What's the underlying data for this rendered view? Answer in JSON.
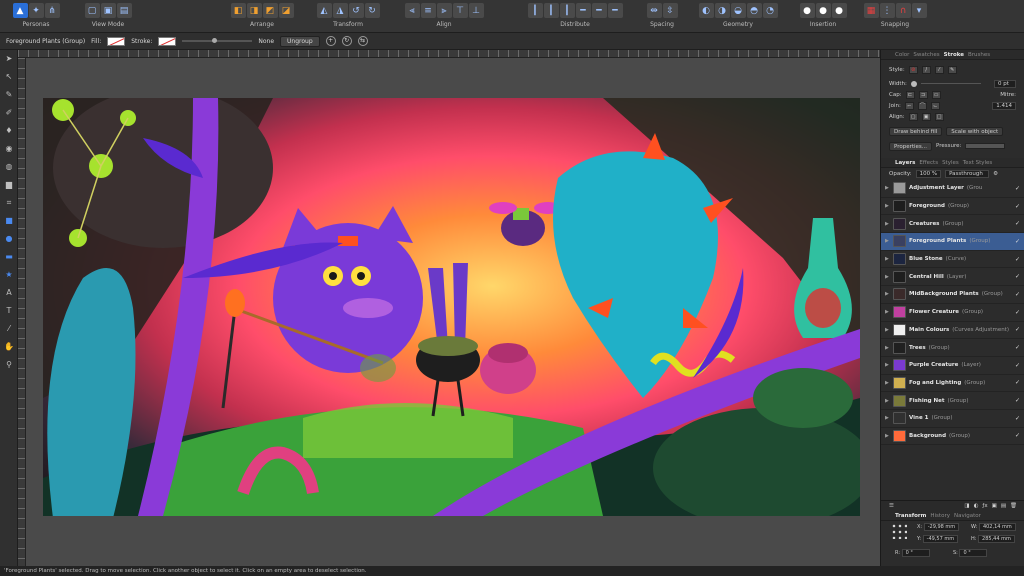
{
  "toolbar": {
    "groups": [
      {
        "label": "Personas",
        "icons": [
          "designer-persona-icon",
          "pixel-persona-icon",
          "export-persona-icon"
        ]
      },
      {
        "label": "View Mode",
        "icons": [
          "view-mode-1-icon",
          "view-mode-2-icon",
          "view-mode-3-icon"
        ]
      },
      {
        "label": "Arrange",
        "icons": [
          "arrange-back-icon",
          "arrange-backward-icon",
          "arrange-forward-icon",
          "arrange-front-icon"
        ]
      },
      {
        "label": "Transform",
        "icons": [
          "flip-horizontal-icon",
          "flip-vertical-icon",
          "rotate-left-icon",
          "rotate-right-icon"
        ]
      },
      {
        "label": "Align",
        "icons": [
          "align-left-icon",
          "align-center-icon",
          "align-right-icon",
          "align-top-icon",
          "align-middle-icon"
        ]
      },
      {
        "label": "Distribute",
        "icons": [
          "distribute-1-icon",
          "distribute-2-icon",
          "distribute-3-icon",
          "distribute-4-icon",
          "distribute-5-icon",
          "distribute-6-icon"
        ]
      },
      {
        "label": "Spacing",
        "icons": [
          "spacing-1-icon",
          "spacing-2-icon"
        ]
      },
      {
        "label": "Geometry",
        "icons": [
          "geometry-add-icon",
          "geometry-subtract-icon",
          "geometry-intersect-icon",
          "geometry-xor-icon",
          "geometry-divide-icon"
        ]
      },
      {
        "label": "Insertion",
        "icons": [
          "insert-behind-icon",
          "insert-top-icon",
          "insert-inside-icon"
        ]
      },
      {
        "label": "Snapping",
        "icons": [
          "snapping-grid-icon",
          "snapping-1-icon",
          "snapping-magnet-icon",
          "snapping-dropdown-icon"
        ]
      }
    ]
  },
  "context": {
    "selection": "Foreground Plants (Group)",
    "fill_label": "Fill:",
    "stroke_label": "Stroke:",
    "stroke_value": "None",
    "ungroup": "Ungroup"
  },
  "panel": {
    "top_tabs": [
      "Color",
      "Swatches",
      "Stroke",
      "Brushes"
    ],
    "top_active": "Stroke",
    "style_label": "Style:",
    "width_label": "Width:",
    "width_value": "0 pt",
    "cap_label": "Cap:",
    "join_label": "Join:",
    "align_label": "Align:",
    "mitre_label": "Mitre:",
    "mitre_value": "1.414",
    "draw_behind": "Draw behind fill",
    "scale_with_object": "Scale with object",
    "properties": "Properties...",
    "pressure": "Pressure:",
    "layer_tabs": [
      "Layers",
      "Effects",
      "Styles",
      "Text Styles"
    ],
    "opacity_label": "Opacity:",
    "opacity_value": "100 %",
    "blend_mode": "Passthrough",
    "layers": [
      {
        "name": "Adjustment Layer",
        "type": "(Grou",
        "color": "#9a9a9a"
      },
      {
        "name": "Foreground",
        "type": "(Group)",
        "color": "#1d1d1d"
      },
      {
        "name": "Creatures",
        "type": "(Group)",
        "color": "#2a2030"
      },
      {
        "name": "Foreground Plants",
        "type": "(Group)",
        "color": "#3a4060"
      },
      {
        "name": "Blue Stone",
        "type": "(Curve)",
        "color": "#1c2540"
      },
      {
        "name": "Central Hill",
        "type": "(Layer)",
        "color": "#1e1e1e"
      },
      {
        "name": "MidBackground Plants",
        "type": "(Group)",
        "color": "#3a2a2a"
      },
      {
        "name": "Flower Creature",
        "type": "(Group)",
        "color": "#c040a0"
      },
      {
        "name": "Main Colours",
        "type": "(Curves Adjustment)",
        "color": "#f0f0f0"
      },
      {
        "name": "Trees",
        "type": "(Group)",
        "color": "#202020"
      },
      {
        "name": "Purple Creature",
        "type": "(Layer)",
        "color": "#7a3ad0"
      },
      {
        "name": "Fog and Lighting",
        "type": "(Group)",
        "color": "#d0b050"
      },
      {
        "name": "Fishing Net",
        "type": "(Group)",
        "color": "#7a7a3a"
      },
      {
        "name": "Vine 1",
        "type": "(Group)",
        "color": "#303030"
      },
      {
        "name": "Background",
        "type": "(Group)",
        "color": "#ff6a3a"
      }
    ],
    "selected_layer": 3,
    "transform_tabs": [
      "Transform",
      "History",
      "Navigator"
    ],
    "x_label": "X:",
    "x_value": "-29,98 mm",
    "y_label": "Y:",
    "y_value": "-49,57 mm",
    "w_label": "W:",
    "w_value": "402,14 mm",
    "h_label": "H:",
    "h_value": "285,44 mm",
    "r_label": "R:",
    "r_value": "0 °",
    "s_label": "S:",
    "s_value": "0 °"
  },
  "status": {
    "text": "'Foreground Plants' selected. Drag to move selection. Click another object to select it. Click on an empty area to deselect selection."
  },
  "colors": {
    "accent": "#3b5d93",
    "toolbar": "#353535",
    "panel": "#2c2c2c"
  }
}
